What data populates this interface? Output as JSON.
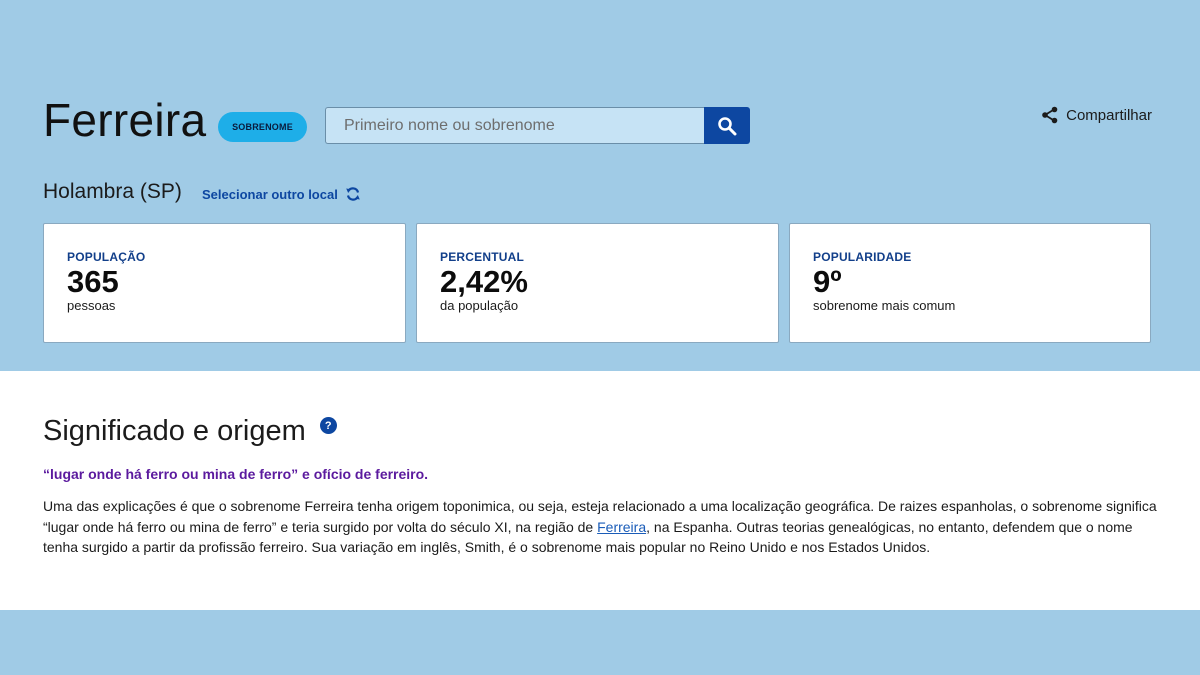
{
  "header": {
    "name": "Ferreira",
    "badge": "SOBRENOME",
    "search_placeholder": "Primeiro nome ou sobrenome",
    "share_label": "Compartilhar"
  },
  "location": {
    "current": "Holambra (SP)",
    "change_label": "Selecionar outro local"
  },
  "stats": [
    {
      "label": "POPULAÇÃO",
      "value": "365",
      "sub": "pessoas"
    },
    {
      "label": "PERCENTUAL",
      "value": "2,42%",
      "sub": "da população"
    },
    {
      "label": "POPULARIDADE",
      "value": "9º",
      "sub": "sobrenome mais comum"
    }
  ],
  "meaning": {
    "title": "Significado e origem",
    "help_icon_glyph": "?",
    "quote": "“lugar onde há ferro ou mina de ferro” e ofício de ferreiro.",
    "paragraph_before_link": "Uma das explicações é que o sobrenome Ferreira tenha origem toponimica, ou seja, esteja relacionado a uma localização geográfica. De raizes espanholas, o sobrenome significa “lugar onde há ferro ou mina de ferro” e teria surgido por volta do século XI, na região de ",
    "link_text": "Ferreira",
    "paragraph_after_link": ", na Espanha. Outras teorias genealógicas, no entanto, defendem que o nome tenha surgido a partir da profissão ferreiro. Sua variação em inglês, Smith, é o sobrenome mais popular no Reino Unido e nos Estados Unidos."
  },
  "colors": {
    "background": "#a0cbe6",
    "accent": "#0d47a1",
    "badge": "#1eaee8",
    "quote": "#5b1a9e"
  },
  "icons": {
    "search": "search-icon",
    "share": "share-icon",
    "refresh": "refresh-icon",
    "help": "help-icon"
  }
}
